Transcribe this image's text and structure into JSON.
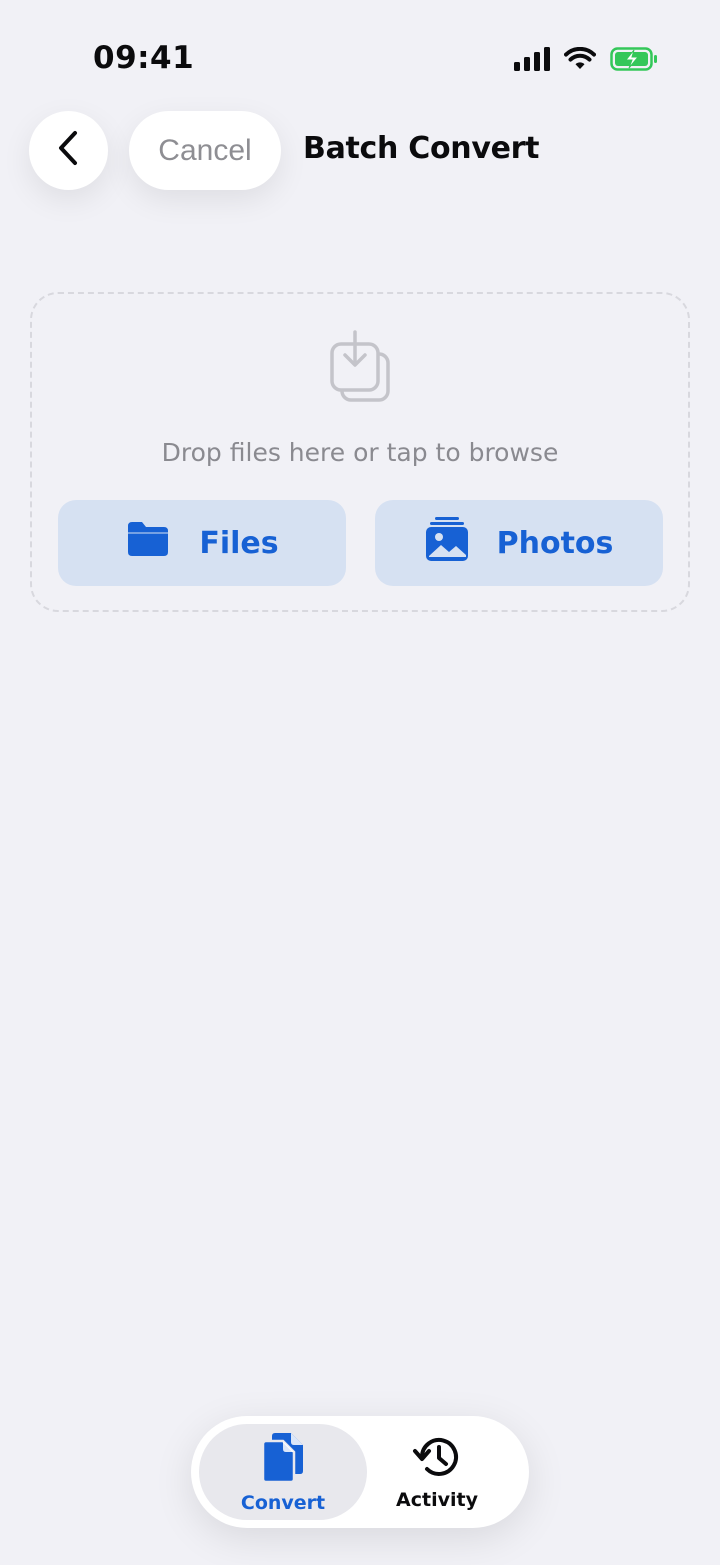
{
  "status_bar": {
    "time": "09:41",
    "icons": [
      "signal-icon",
      "wifi-icon",
      "battery-charging-icon"
    ],
    "battery_color": "#34c759"
  },
  "header": {
    "back_icon": "chevron-left-icon",
    "cancel_label": "Cancel",
    "title": "Batch Convert"
  },
  "drop_zone": {
    "icon": "import-tray-icon",
    "text": "Drop files here or tap to browse",
    "buttons": [
      {
        "label": "Files",
        "icon": "folder-icon"
      },
      {
        "label": "Photos",
        "icon": "photo-stack-icon"
      }
    ]
  },
  "tab_bar": {
    "tabs": [
      {
        "label": "Convert",
        "icon": "documents-icon",
        "selected": true
      },
      {
        "label": "Activity",
        "icon": "history-clock-icon",
        "selected": false
      }
    ]
  },
  "colors": {
    "accent": "#1761d4",
    "background": "#f1f1f6",
    "button_fill": "#d6e1f2"
  }
}
